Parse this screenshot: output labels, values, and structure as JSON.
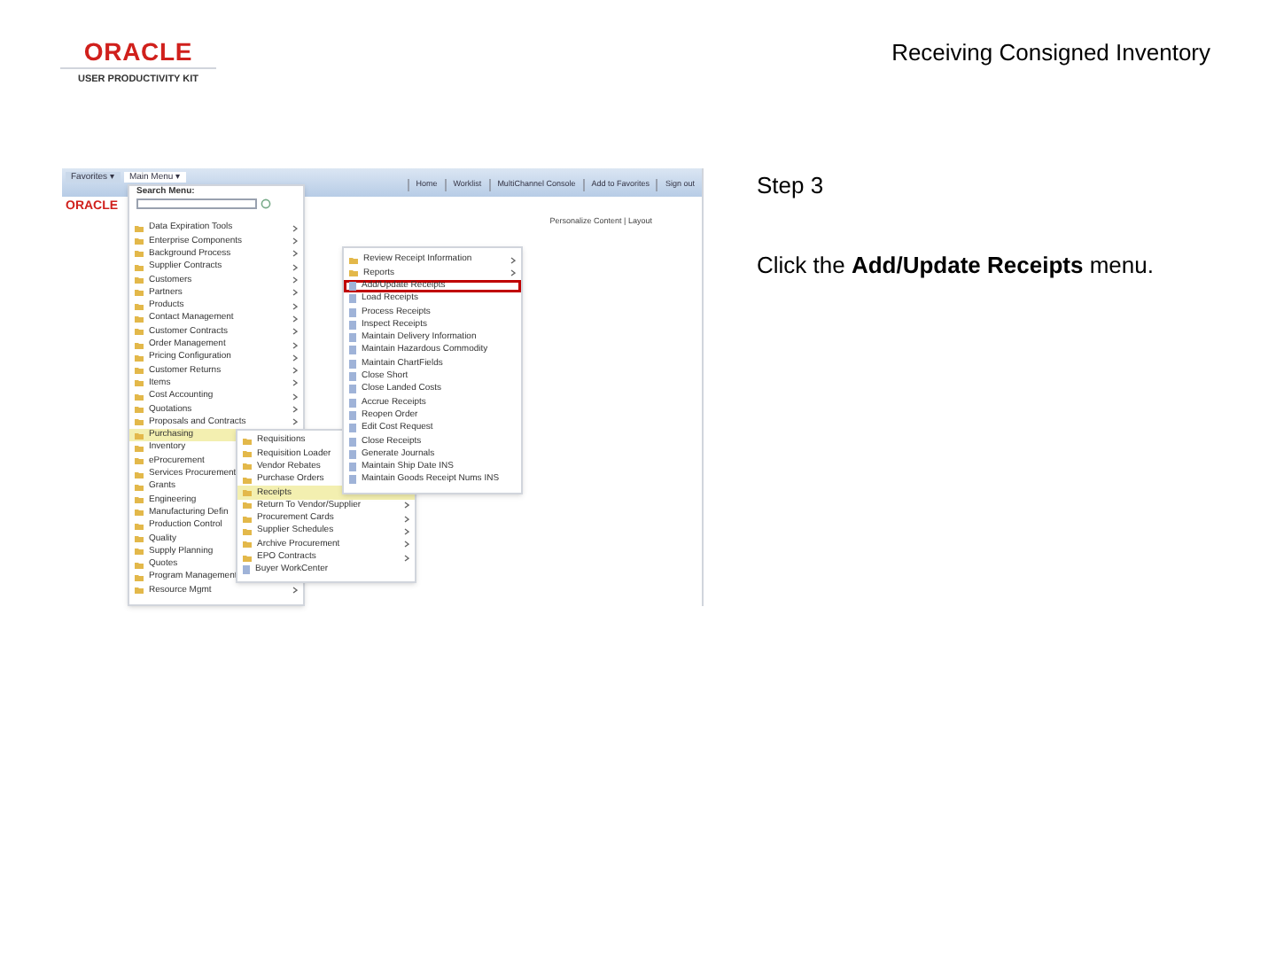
{
  "header": {
    "logo": "ORACLE",
    "logo_subtitle": "USER PRODUCTIVITY KIT",
    "title": "Receiving Consigned Inventory"
  },
  "screenshot": {
    "nav_tabs": [
      {
        "label": "Favorites ▾",
        "selected": false
      },
      {
        "label": "Main Menu ▾",
        "selected": true
      }
    ],
    "brand": "ORACLE",
    "search_label": "Search Menu:",
    "top_links": [
      "Home",
      "Worklist",
      "MultiChannel Console",
      "Add to Favorites",
      "Sign out"
    ],
    "personalize": "Personalize Content | Layout",
    "main_menu": [
      {
        "label": "Data Expiration Tools",
        "kind": "folder",
        "selected": false,
        "has_submenu": true
      },
      {
        "label": "Enterprise Components",
        "kind": "folder",
        "selected": false,
        "has_submenu": true
      },
      {
        "label": "Background Process",
        "kind": "folder",
        "selected": false,
        "has_submenu": true
      },
      {
        "label": "Supplier Contracts",
        "kind": "folder",
        "selected": false,
        "has_submenu": true
      },
      {
        "label": "Customers",
        "kind": "folder",
        "selected": false,
        "has_submenu": true
      },
      {
        "label": "Partners",
        "kind": "folder",
        "selected": false,
        "has_submenu": true
      },
      {
        "label": "Products",
        "kind": "folder",
        "selected": false,
        "has_submenu": true
      },
      {
        "label": "Contact Management",
        "kind": "folder",
        "selected": false,
        "has_submenu": true
      },
      {
        "label": "Customer Contracts",
        "kind": "folder",
        "selected": false,
        "has_submenu": true
      },
      {
        "label": "Order Management",
        "kind": "folder",
        "selected": false,
        "has_submenu": true
      },
      {
        "label": "Pricing Configuration",
        "kind": "folder",
        "selected": false,
        "has_submenu": true
      },
      {
        "label": "Customer Returns",
        "kind": "folder",
        "selected": false,
        "has_submenu": true
      },
      {
        "label": "Items",
        "kind": "folder",
        "selected": false,
        "has_submenu": true
      },
      {
        "label": "Cost Accounting",
        "kind": "folder",
        "selected": false,
        "has_submenu": true
      },
      {
        "label": "Quotations",
        "kind": "folder",
        "selected": false,
        "has_submenu": true
      },
      {
        "label": "Proposals and Contracts",
        "kind": "folder",
        "selected": false,
        "has_submenu": true
      },
      {
        "label": "Purchasing",
        "kind": "folder",
        "selected": true,
        "has_submenu": true
      },
      {
        "label": "Inventory",
        "kind": "folder",
        "selected": false
      },
      {
        "label": "eProcurement",
        "kind": "folder",
        "selected": false
      },
      {
        "label": "Services Procurement",
        "kind": "folder",
        "selected": false
      },
      {
        "label": "Grants",
        "kind": "folder",
        "selected": false
      },
      {
        "label": "Engineering",
        "kind": "folder",
        "selected": false
      },
      {
        "label": "Manufacturing Defin",
        "kind": "folder",
        "selected": false
      },
      {
        "label": "Production Control",
        "kind": "folder",
        "selected": false
      },
      {
        "label": "Quality",
        "kind": "folder",
        "selected": false
      },
      {
        "label": "Supply Planning",
        "kind": "folder",
        "selected": false
      },
      {
        "label": "Quotes",
        "kind": "folder",
        "selected": false
      },
      {
        "label": "Program Management",
        "kind": "folder",
        "selected": false
      },
      {
        "label": "Resource Mgmt",
        "kind": "folder",
        "selected": false,
        "has_submenu": true
      }
    ],
    "purchasing_menu": [
      {
        "label": "Requisitions",
        "kind": "folder",
        "selected": false
      },
      {
        "label": "Requisition Loader",
        "kind": "folder",
        "selected": false
      },
      {
        "label": "Vendor Rebates",
        "kind": "folder",
        "selected": false
      },
      {
        "label": "Purchase Orders",
        "kind": "folder",
        "selected": false
      },
      {
        "label": "Receipts",
        "kind": "folder",
        "selected": true
      },
      {
        "label": "Return To Vendor/Supplier",
        "kind": "folder",
        "selected": false,
        "has_submenu": true
      },
      {
        "label": "Procurement Cards",
        "kind": "folder",
        "selected": false,
        "has_submenu": true
      },
      {
        "label": "Supplier Schedules",
        "kind": "folder",
        "selected": false,
        "has_submenu": true
      },
      {
        "label": "Archive Procurement",
        "kind": "folder",
        "selected": false,
        "has_submenu": true
      },
      {
        "label": "EPO Contracts",
        "kind": "folder",
        "selected": false,
        "has_submenu": true
      },
      {
        "label": "Buyer WorkCenter",
        "kind": "page",
        "selected": false,
        "has_submenu": false
      }
    ],
    "receipts_menu": [
      {
        "label": "Review Receipt Information",
        "kind": "folder",
        "highlighted": false,
        "has_submenu": true
      },
      {
        "label": "Reports",
        "kind": "folder",
        "highlighted": false,
        "has_submenu": true
      },
      {
        "label": "Add/Update Receipts",
        "kind": "page",
        "highlighted": true,
        "has_submenu": false
      },
      {
        "label": "Load Receipts",
        "kind": "page",
        "highlighted": false,
        "has_submenu": false
      },
      {
        "label": "Process Receipts",
        "kind": "page",
        "highlighted": false,
        "has_submenu": false
      },
      {
        "label": "Inspect Receipts",
        "kind": "page",
        "highlighted": false,
        "has_submenu": false
      },
      {
        "label": "Maintain Delivery Information",
        "kind": "page",
        "highlighted": false,
        "has_submenu": false
      },
      {
        "label": "Maintain Hazardous Commodity",
        "kind": "page",
        "highlighted": false,
        "has_submenu": false
      },
      {
        "label": "Maintain ChartFields",
        "kind": "page",
        "highlighted": false,
        "has_submenu": false
      },
      {
        "label": "Close Short",
        "kind": "page",
        "highlighted": false,
        "has_submenu": false
      },
      {
        "label": "Close Landed Costs",
        "kind": "page",
        "highlighted": false,
        "has_submenu": false
      },
      {
        "label": "Accrue Receipts",
        "kind": "page",
        "highlighted": false,
        "has_submenu": false
      },
      {
        "label": "Reopen Order",
        "kind": "page",
        "highlighted": false,
        "has_submenu": false
      },
      {
        "label": "Edit Cost Request",
        "kind": "page",
        "highlighted": false,
        "has_submenu": false
      },
      {
        "label": "Close Receipts",
        "kind": "page",
        "highlighted": false,
        "has_submenu": false
      },
      {
        "label": "Generate Journals",
        "kind": "page",
        "highlighted": false,
        "has_submenu": false
      },
      {
        "label": "Maintain Ship Date INS",
        "kind": "page",
        "highlighted": false,
        "has_submenu": false
      },
      {
        "label": "Maintain Goods Receipt Nums INS",
        "kind": "page",
        "highlighted": false,
        "has_submenu": false
      }
    ]
  },
  "step": {
    "title": "Step 3",
    "instruction": "Click the **Add/Update Receipts** menu."
  }
}
